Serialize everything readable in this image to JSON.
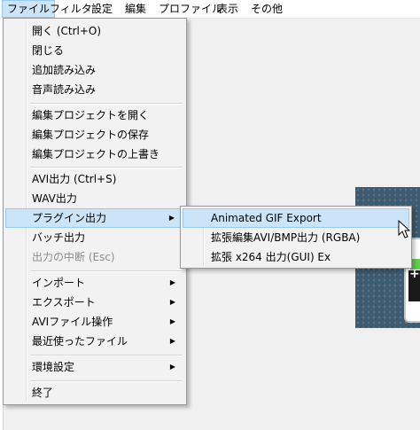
{
  "menubar": {
    "items": [
      "ファイル",
      "フィルタ",
      "設定",
      "編集",
      "プロファイル",
      "表示",
      "その他"
    ]
  },
  "file_menu": {
    "items": [
      {
        "label": "開く (Ctrl+O)"
      },
      {
        "label": "閉じる"
      },
      {
        "label": "追加読み込み"
      },
      {
        "label": "音声読み込み"
      },
      {
        "label": "編集プロジェクトを開く"
      },
      {
        "label": "編集プロジェクトの保存"
      },
      {
        "label": "編集プロジェクトの上書き"
      },
      {
        "label": "AVI出力 (Ctrl+S)"
      },
      {
        "label": "WAV出力"
      },
      {
        "label": "プラグイン出力",
        "submenu": true
      },
      {
        "label": "バッチ出力"
      },
      {
        "label": "出力の中断 (Esc)",
        "disabled": true
      },
      {
        "label": "インポート",
        "submenu": true
      },
      {
        "label": "エクスポート",
        "submenu": true
      },
      {
        "label": "AVIファイル操作",
        "submenu": true
      },
      {
        "label": "最近使ったファイル",
        "submenu": true
      },
      {
        "label": "環境設定",
        "submenu": true
      },
      {
        "label": "終了"
      }
    ]
  },
  "plugin_submenu": {
    "items": [
      {
        "label": "Animated GIF Export"
      },
      {
        "label": "拡張編集AVI/BMP出力 (RGBA)"
      },
      {
        "label": "拡張 x264 出力(GUI) Ex"
      }
    ]
  },
  "colors": {
    "highlight": "#cce4f7",
    "highlight_border": "#99c9ef",
    "preview_bg": "#3e5b70"
  }
}
